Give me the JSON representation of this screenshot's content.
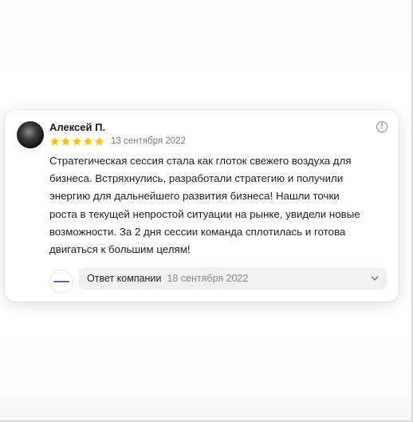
{
  "review": {
    "author": "Алексей П.",
    "rating": 5,
    "rating_max": 5,
    "date": "13 сентября 2022",
    "text_lines": [
      "Стратегическая сессия стала как глоток свежего воздуха для",
      "бизнеса. Встряхнулись, разработали стратегию и получили",
      "энергию для дальнейшего развития бизнеса! Нашли точки",
      "роста в текущей непростой ситуации на рынке, увидели новые",
      "возможности. За 2 дня сессии команда сплотилась и готова",
      "двигаться к большим целям!"
    ],
    "info_icon": "info-icon"
  },
  "company_reply": {
    "label": "Ответ компании",
    "date": "18 сентября 2022",
    "expand_icon": "chevron-down-icon"
  },
  "colors": {
    "star": "#fdc10f",
    "reply_background": "#f0f0f0",
    "muted_text": "#7a7a7a"
  }
}
